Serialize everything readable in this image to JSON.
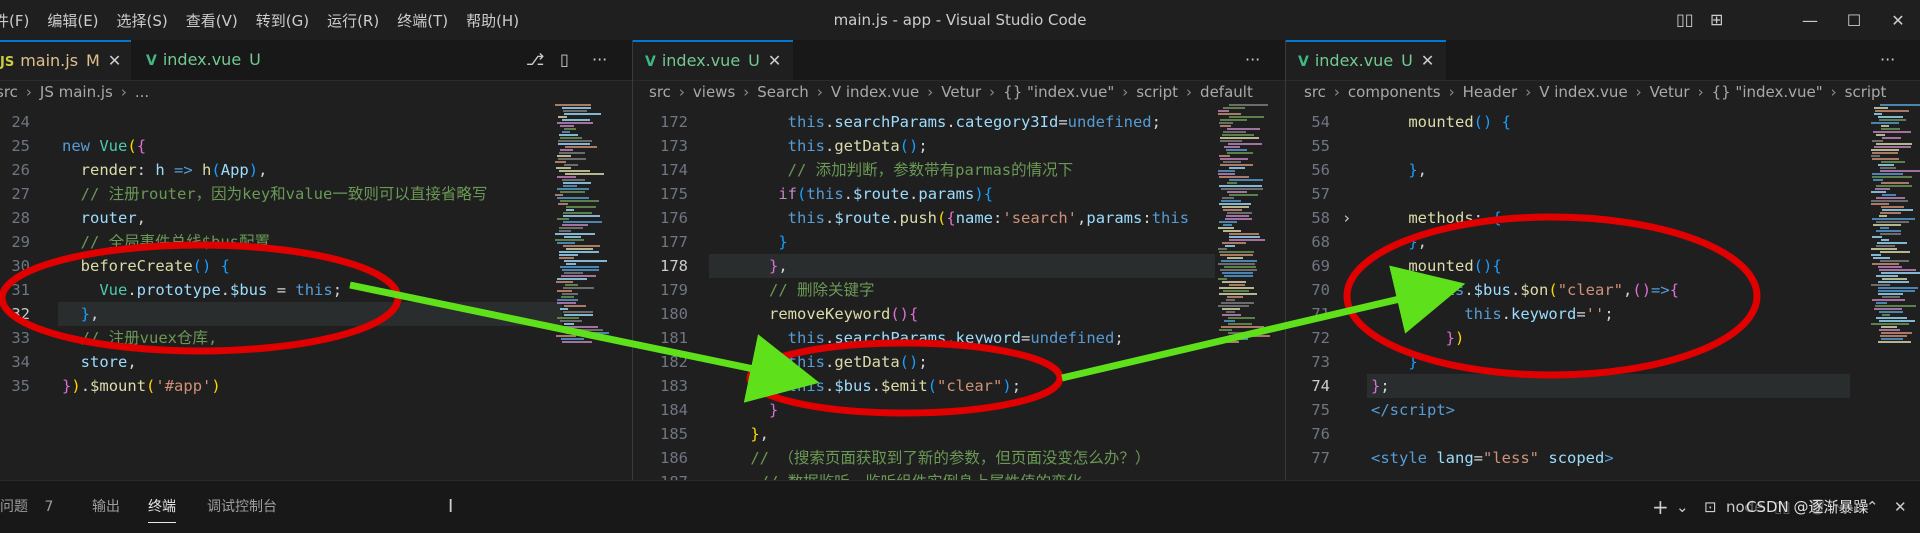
{
  "menu": [
    "件(F)",
    "编辑(E)",
    "选择(S)",
    "查看(V)",
    "转到(G)",
    "运行(R)",
    "终端(T)",
    "帮助(H)"
  ],
  "window_title": "main.js - app - Visual Studio Code",
  "window_controls": {
    "layout1": "▯▯",
    "layout2": "⊞",
    "min": "—",
    "max": "☐",
    "close": "✕"
  },
  "pane1": {
    "tabs": [
      {
        "icon": "JS",
        "title": "main.js",
        "badge": "M",
        "close": "✕",
        "active": true
      },
      {
        "icon": "V",
        "title": "index.vue",
        "badge": "U",
        "active": false
      }
    ],
    "actions": [
      "⎇",
      "▯",
      "···"
    ],
    "breadcrumb": [
      "src",
      "›",
      "JS main.js",
      "›",
      "..."
    ],
    "lines": [
      {
        "n": "24",
        "html": ""
      },
      {
        "n": "25",
        "html": "<span class='kw'>new</span> <span class='cls'>Vue</span><span class='br1'>(</span><span class='br2'>{</span>"
      },
      {
        "n": "26",
        "html": "  <span class='fn'>render</span><span class='pl'>: </span><span class='var'>h</span> <span class='kw'>=&gt;</span> <span class='fn'>h</span><span class='br3'>(</span><span class='var'>App</span><span class='br3'>)</span><span class='pl'>,</span>"
      },
      {
        "n": "27",
        "html": "  <span class='cmt'>// 注册router，因为key和value一致则可以直接省略写</span>"
      },
      {
        "n": "28",
        "html": "  <span class='var'>router</span><span class='pl'>,</span>"
      },
      {
        "n": "29",
        "html": "  <span class='cmt'>// 全局事件总线$bus配置</span>"
      },
      {
        "n": "30",
        "html": "  <span class='fn'>beforeCreate</span><span class='br3'>()</span> <span class='br3'>{</span>"
      },
      {
        "n": "31",
        "html": "    <span class='cls'>Vue</span><span class='pl'>.</span><span class='prop'>prototype</span><span class='pl'>.</span><span class='prop'>$bus</span> <span class='pl'>=</span> <span class='this'>this</span><span class='pl'>;</span>"
      },
      {
        "n": "32",
        "html": "  <span class='br3'>}</span><span class='pl'>,</span>",
        "current": true
      },
      {
        "n": "33",
        "html": "  <span class='cmt'>// 注册vuex仓库,</span>"
      },
      {
        "n": "34",
        "html": "  <span class='var'>store</span><span class='pl'>,</span>"
      },
      {
        "n": "35",
        "html": "<span class='br2'>}</span><span class='br1'>)</span><span class='pl'>.</span><span class='fn'>$mount</span><span class='br1'>(</span><span class='str'>'#app'</span><span class='br1'>)</span>"
      }
    ]
  },
  "pane2": {
    "tabs": [
      {
        "icon": "V",
        "title": "index.vue",
        "badge": "U",
        "close": "✕",
        "active": true
      }
    ],
    "actions": [
      "···"
    ],
    "breadcrumb": [
      "src",
      "›",
      "views",
      "›",
      "Search",
      "›",
      "V index.vue",
      "›",
      "Vetur",
      "›",
      "{} \"index.vue\"",
      "›",
      "script",
      "›",
      "default"
    ],
    "lines": [
      {
        "n": "172",
        "html": "        <span class='this'>this</span><span class='pl'>.</span><span class='prop'>searchParams</span><span class='pl'>.</span><span class='prop'>category3Id</span><span class='pl'>=</span><span class='kw'>undefined</span><span class='pl'>;</span>"
      },
      {
        "n": "173",
        "html": "        <span class='this'>this</span><span class='pl'>.</span><span class='fn'>getData</span><span class='br3'>()</span><span class='pl'>;</span>"
      },
      {
        "n": "174",
        "html": "        <span class='cmt'>// 添加判断，参数带有parmas的情况下</span>"
      },
      {
        "n": "175",
        "html": "       <span class='ctl'>if</span><span class='br3'>(</span><span class='this'>this</span><span class='pl'>.</span><span class='prop'>$route</span><span class='pl'>.</span><span class='prop'>params</span><span class='br3'>)</span><span class='br3'>{</span>"
      },
      {
        "n": "176",
        "html": "        <span class='this'>this</span><span class='pl'>.</span><span class='prop'>$route</span><span class='pl'>.</span><span class='fn'>push</span><span class='br1'>(</span><span class='br2'>{</span><span class='prop'>name</span><span class='pl'>:</span><span class='str'>'search'</span><span class='pl'>,</span><span class='prop'>params</span><span class='pl'>:</span><span class='this'>this</span>"
      },
      {
        "n": "177",
        "html": "       <span class='br3'>}</span>"
      },
      {
        "n": "178",
        "html": "      <span class='br2'>}</span><span class='pl'>,</span>",
        "current": true
      },
      {
        "n": "179",
        "html": "      <span class='cmt'>// 删除关键字</span>"
      },
      {
        "n": "180",
        "html": "      <span class='fn'>removeKeyword</span><span class='br2'>()</span><span class='br2'>{</span>"
      },
      {
        "n": "181",
        "html": "        <span class='this'>this</span><span class='pl'>.</span><span class='prop'>searchParams</span><span class='pl'>.</span><span class='prop'>keyword</span><span class='pl'>=</span><span class='kw'>undefined</span><span class='pl'>;</span>"
      },
      {
        "n": "182",
        "html": "        <span class='this'>this</span><span class='pl'>.</span><span class='fn'>getData</span><span class='br3'>()</span><span class='pl'>;</span>"
      },
      {
        "n": "183",
        "html": "        <span class='this'>this</span><span class='pl'>.</span><span class='prop'>$bus</span><span class='pl'>.</span><span class='fn'>$emit</span><span class='br3'>(</span><span class='str'>\"clear\"</span><span class='br3'>)</span><span class='pl'>;</span>"
      },
      {
        "n": "184",
        "html": "      <span class='br2'>}</span>"
      },
      {
        "n": "185",
        "html": "    <span class='br1'>}</span><span class='pl'>,</span>"
      },
      {
        "n": "186",
        "html": "    <span class='cmt'>// （搜索页面获取到了新的参数，但页面没变怎么办？）</span>"
      },
      {
        "n": "187",
        "html": "     <span class='cmt'>// 数据监听，监听组件实例身上属性值的变化</span>"
      }
    ]
  },
  "pane3": {
    "tabs": [
      {
        "icon": "V",
        "title": "index.vue",
        "badge": "U",
        "close": "✕",
        "active": true
      }
    ],
    "actions": [
      "···"
    ],
    "breadcrumb": [
      "src",
      "›",
      "components",
      "›",
      "Header",
      "›",
      "V index.vue",
      "›",
      "Vetur",
      "›",
      "{} \"index.vue\"",
      "›",
      "script"
    ],
    "lines": [
      {
        "n": "54",
        "html": "    <span class='fn'>mounted</span><span class='br3'>()</span> <span class='br3'>{</span>"
      },
      {
        "n": "55",
        "html": ""
      },
      {
        "n": "56",
        "html": "    <span class='br3'>}</span><span class='pl'>,</span>"
      },
      {
        "n": "57",
        "html": ""
      },
      {
        "n": "58",
        "html": "    <span class='fn'>methods</span><span class='pl'>: </span><span class='br3'>{</span><span class='pl'>···</span>",
        "fold": true
      },
      {
        "n": "68",
        "html": "    <span class='br3'>}</span><span class='pl'>,</span>"
      },
      {
        "n": "69",
        "html": "    <span class='fn'>mounted</span><span class='br3'>()</span><span class='br3'>{</span>"
      },
      {
        "n": "70",
        "html": "      <span class='this'>this</span><span class='pl'>.</span><span class='prop'>$bus</span><span class='pl'>.</span><span class='fn'>$on</span><span class='br1'>(</span><span class='str'>\"clear\"</span><span class='pl'>,</span><span class='br2'>()</span><span class='kw'>=&gt;</span><span class='br2'>{</span>"
      },
      {
        "n": "71",
        "html": "          <span class='this'>this</span><span class='pl'>.</span><span class='prop'>keyword</span><span class='pl'>=</span><span class='str'>''</span><span class='pl'>;</span>"
      },
      {
        "n": "72",
        "html": "        <span class='br2'>}</span><span class='br1'>)</span>"
      },
      {
        "n": "73",
        "html": "    <span class='br3'>}</span>"
      },
      {
        "n": "74",
        "html": "<span class='br2'>}</span><span class='pl'>;</span>",
        "current": true
      },
      {
        "n": "75",
        "html": "<span class='tag'>&lt;/script&gt;</span>"
      },
      {
        "n": "76",
        "html": ""
      },
      {
        "n": "77",
        "html": "<span class='tag'>&lt;style</span> <span class='attr'>lang</span><span class='pl'>=</span><span class='str'>\"less\"</span> <span class='attr'>scoped</span><span class='tag'>&gt;</span>"
      }
    ]
  },
  "panel": {
    "tabs": [
      {
        "label": "问题",
        "count": "7"
      },
      {
        "label": "输出"
      },
      {
        "label": "终端",
        "active": true
      },
      {
        "label": "调试控制台"
      }
    ],
    "right": {
      "add": "+",
      "chevron": "⌄",
      "shell_icon": "⊡",
      "shell": "node",
      "split": "▯▯",
      "trash": "🗑",
      "more": "···",
      "up": "⌃",
      "close": "✕"
    },
    "watermark": "CSDN @逐渐暴躁"
  }
}
